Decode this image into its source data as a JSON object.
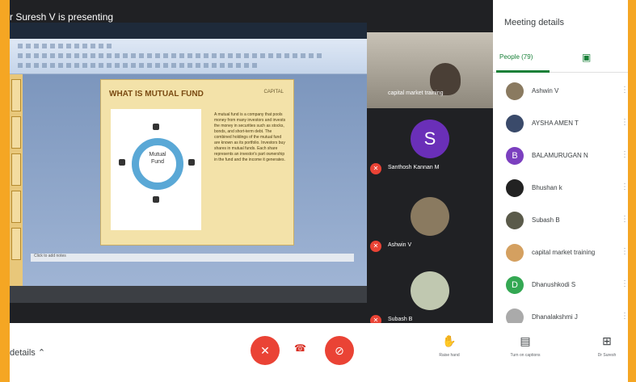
{
  "meeting": {
    "presenting_text": "r Suresh V is presenting",
    "sidebar_title": "Meeting details",
    "tab_people": "People (79)"
  },
  "slide": {
    "title": "WHAT IS MUTUAL FUND",
    "center_label": "Mutual\nFund",
    "logo": "CAPITAL",
    "body_text": "A mutual fund is a company that pools money from many investors and invests the money in securities such as stocks, bonds, and short-term debt. The combined holdings of the mutual fund are known as its portfolio. Investors buy shares in mutual funds. Each share represents an investor's part ownership in the fund and the income it generates.",
    "status": "Click to add notes"
  },
  "tiles": [
    {
      "name": "capital market training",
      "type": "video"
    },
    {
      "name": "Santhosh Kannan M",
      "initial": "S",
      "color": "#6a2fb8"
    },
    {
      "name": "Ashwin V",
      "initial": "",
      "color": "#8a7a60"
    },
    {
      "name": "Subash B",
      "initial": "",
      "color": "#c0c8b0"
    }
  ],
  "people": [
    {
      "name": "Ashwin V",
      "initial": "",
      "color": "#8a7a60"
    },
    {
      "name": "AYSHA AMEN T",
      "initial": "",
      "color": "#3a4a6a"
    },
    {
      "name": "BALAMURUGAN N",
      "initial": "B",
      "color": "#7b3fbf"
    },
    {
      "name": "Bhushan k",
      "initial": "",
      "color": "#222"
    },
    {
      "name": "Subash B",
      "initial": "",
      "color": "#5a5a4a"
    },
    {
      "name": "capital market training",
      "initial": "",
      "color": "#d4a060"
    },
    {
      "name": "Dhanushkodi S",
      "initial": "D",
      "color": "#34a853"
    },
    {
      "name": "Dhanalakshmi J",
      "initial": "",
      "color": "#aaa"
    }
  ],
  "bottom": {
    "details_label": "details",
    "raise_hand": "Raise hand",
    "turn_on_captions": "Turn on captions",
    "presenter": "Dr Suresh"
  }
}
